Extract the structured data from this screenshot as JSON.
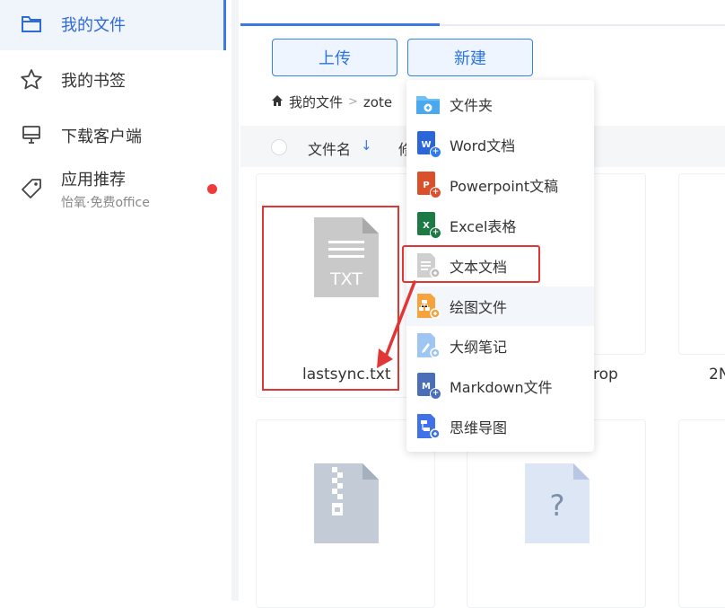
{
  "sidebar": {
    "items": [
      {
        "label": "我的文件",
        "icon": "folder-icon"
      },
      {
        "label": "我的书签",
        "icon": "star-icon"
      },
      {
        "label": "下载客户端",
        "icon": "monitor-icon"
      },
      {
        "label": "应用推荐",
        "icon": "tag-icon",
        "sub": "怡氧·免费office"
      }
    ]
  },
  "toolbar": {
    "upload_label": "上传",
    "new_label": "新建"
  },
  "breadcrumb": {
    "home_label": "我的文件",
    "separator": ">",
    "current": "zote"
  },
  "list_header": {
    "name_label": "文件名",
    "sort_arrow": "↓",
    "modified_label": "修"
  },
  "files": [
    {
      "name": "lastsync.txt",
      "type_label": "TXT"
    },
    {
      "name": "rop"
    },
    {
      "name": "2N"
    },
    {
      "name": "",
      "type": "zip"
    },
    {
      "name": "",
      "type_label": "?"
    }
  ],
  "new_menu": {
    "items": [
      {
        "label": "文件夹",
        "icon": "folder-plus-icon"
      },
      {
        "label": "Word文档",
        "icon": "word-icon",
        "badge": "W"
      },
      {
        "label": "Powerpoint文稿",
        "icon": "powerpoint-icon",
        "badge": "P"
      },
      {
        "label": "Excel表格",
        "icon": "excel-icon",
        "badge": "X"
      },
      {
        "label": "文本文档",
        "icon": "text-doc-icon"
      },
      {
        "label": "绘图文件",
        "icon": "drawing-icon"
      },
      {
        "label": "大纲笔记",
        "icon": "outline-note-icon"
      },
      {
        "label": "Markdown文件",
        "icon": "markdown-icon",
        "badge": "M"
      },
      {
        "label": "思维导图",
        "icon": "mindmap-icon"
      }
    ]
  },
  "colors": {
    "accent": "#3b7ae0",
    "annotation_red": "#e23636",
    "word": "#2b66d9",
    "powerpoint": "#d9502b",
    "excel": "#1e7a44",
    "markdown": "#4a6fb8"
  }
}
